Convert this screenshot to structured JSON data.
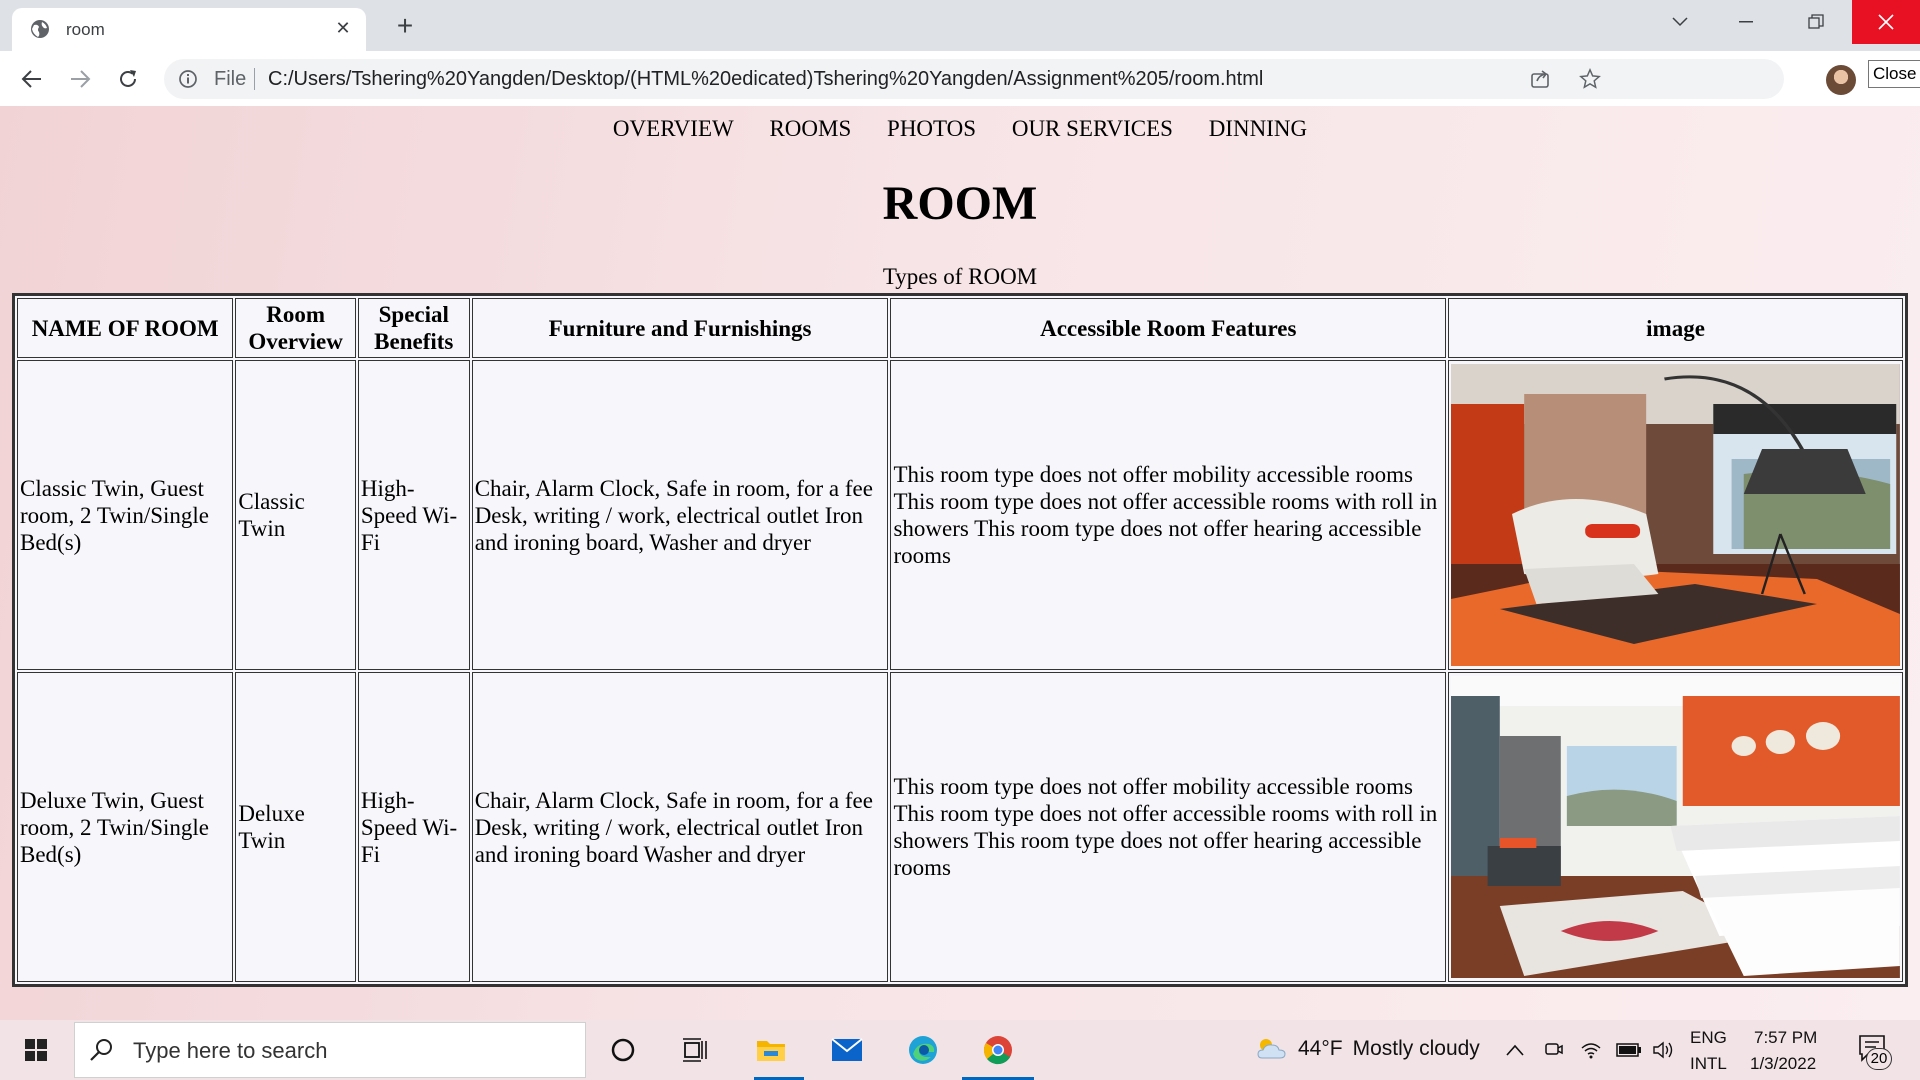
{
  "browser": {
    "tab_title": "room",
    "url_scheme": "File",
    "url": "C:/Users/Tshering%20Yangden/Desktop/(HTML%20edicated)Tshering%20Yangden/Assignment%205/room.html",
    "tooltip": "Close"
  },
  "nav": [
    "OVERVIEW",
    "ROOMS",
    "PHOTOS",
    "OUR SERVICES",
    "DINNING"
  ],
  "page_title": "ROOM",
  "table": {
    "caption": "Types of ROOM",
    "headers": [
      "NAME OF ROOM",
      "Room Overview",
      "Special Benefits",
      "Furniture and Furnishings",
      "Accessible Room Features",
      "image"
    ],
    "rows": [
      {
        "name": "Classic Twin, Guest room, 2 Twin/Single Bed(s)",
        "overview": "Classic Twin",
        "benefits": "High-Speed Wi-Fi",
        "furniture": "Chair, Alarm Clock, Safe in room, for a fee Desk, writing / work, electrical outlet Iron and ironing board, Washer and dryer",
        "accessible": "This room type does not offer mobility accessible rooms This room type does not offer accessible rooms with roll in showers This room type does not offer hearing accessible rooms",
        "image_icon": "room-photo-lounge-chair"
      },
      {
        "name": "Deluxe Twin, Guest room, 2 Twin/Single Bed(s)",
        "overview": "Deluxe Twin",
        "benefits": "High-Speed Wi-Fi",
        "furniture": "Chair, Alarm Clock, Safe in room, for a fee Desk, writing / work, electrical outlet Iron and ironing board Washer and dryer",
        "accessible": "This room type does not offer mobility accessible rooms This room type does not offer accessible rooms with roll in showers This room type does not offer hearing accessible rooms",
        "image_icon": "room-photo-twin-beds"
      }
    ]
  },
  "taskbar": {
    "search_placeholder": "Type here to search",
    "weather_temp": "44°F",
    "weather_text": "Mostly cloudy",
    "lang_1": "ENG",
    "lang_2": "INTL",
    "time": "7:57 PM",
    "date": "1/3/2022",
    "notifications": "20"
  },
  "colors": {
    "accent_orange": "#e8542a",
    "close_red": "#e81123",
    "taskbar_active": "#0067c0"
  }
}
